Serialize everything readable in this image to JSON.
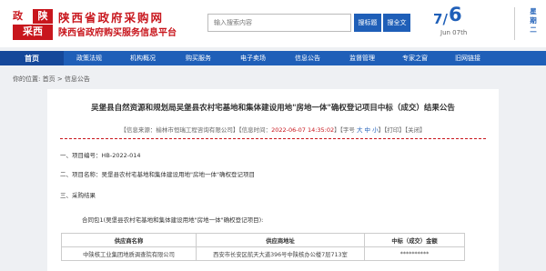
{
  "header": {
    "logo": {
      "c1": "政",
      "c2": "陕",
      "c3": "采西"
    },
    "site_name": "陕西省政府采购网",
    "site_sub": "陕西省政府购买服务信息平台",
    "search": {
      "placeholder": "输入搜索内容",
      "btn1": "搜标题",
      "btn2": "搜全文"
    },
    "date": {
      "month": "7",
      "day": "6",
      "en": "Jun 07th",
      "weekday": "星期二"
    }
  },
  "nav": {
    "items": [
      {
        "label": "首页",
        "active": true
      },
      {
        "label": "政策法规"
      },
      {
        "label": "机构概况"
      },
      {
        "label": "购买服务"
      },
      {
        "label": "电子卖场"
      },
      {
        "label": "信息公告"
      },
      {
        "label": "监督管理"
      },
      {
        "label": "专家之窗"
      },
      {
        "label": "旧网链接"
      }
    ]
  },
  "breadcrumb": {
    "prefix": "你的位置:",
    "home": "首页",
    "sep": " > ",
    "current": "信息公告"
  },
  "article": {
    "title": "吴堡县自然资源和规划局吴堡县农村宅基地和集体建设用地\"房地一体\"确权登记项目中标（成交）结果公告",
    "meta": {
      "source": "【信息来源：榆林市恒瑞工程咨询有限公司】【信息时间：",
      "date": "2022-06-07 14:35:02",
      "size_prefix": "】【字号 ",
      "size_options": "大 中 小",
      "tail": "】【打印】【关闭】"
    },
    "p1": "一、项目编号：HB-2022-014",
    "p2": "二、项目名称：吴堡县农村宅基地和集体建设用地\"房地一体\"确权登记项目",
    "p3": "三、采购结果",
    "p4": "合同包1(吴堡县农村宅基地和集体建设用地\"房地一体\"确权登记项目):",
    "table": {
      "headers": [
        "供应商名称",
        "供应商地址",
        "中标（成交）金额"
      ],
      "rows": [
        [
          "中陕核工业集团地质调查院有限公司",
          "西安市长安区航天大道396号中陕核办公楼7层713室",
          "**********"
        ]
      ]
    }
  },
  "colors": {
    "brand_red": "#c8161d",
    "nav_blue": "#1f5fb8",
    "nav_active": "#15489a"
  }
}
